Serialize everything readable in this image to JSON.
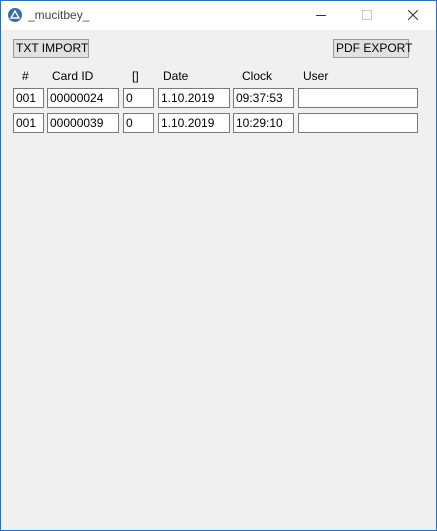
{
  "window": {
    "title": "_mucitbey_"
  },
  "toolbar": {
    "import_label": "TXT IMPORT",
    "export_label": "PDF EXPORT"
  },
  "table": {
    "headers": {
      "num": "#",
      "card_id": "Card ID",
      "flag": "[]",
      "date": "Date",
      "clock": "Clock",
      "user": "User"
    },
    "rows": [
      {
        "num": "001",
        "card_id": "00000024",
        "flag": "0",
        "date": "1.10.2019",
        "clock": "09:37:53",
        "user": ""
      },
      {
        "num": "001",
        "card_id": "00000039",
        "flag": "0",
        "date": "1.10.2019",
        "clock": "10:29:10",
        "user": ""
      }
    ]
  },
  "colors": {
    "frame": "#1e73c8",
    "client_bg": "#f0f0f0",
    "titlebar_bg": "#ffffff",
    "button_bg": "#e1e1e1"
  },
  "icons": {
    "app": "app-logo-icon",
    "minimize": "minimize-icon",
    "maximize": "maximize-icon",
    "close": "close-icon"
  }
}
